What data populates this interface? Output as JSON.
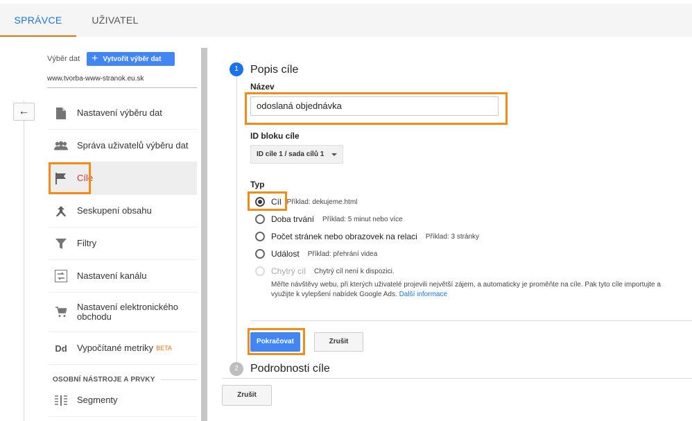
{
  "tabs": [
    {
      "label": "SPRÁVCE",
      "active": true
    },
    {
      "label": "UŽIVATEL",
      "active": false
    }
  ],
  "sidebar": {
    "view_label": "Výběr dat",
    "create_view_label": "Vytvořit výběr dat",
    "view_name": "www.tvorba-www-stranok.eu.sk",
    "back_icon": "arrow-left-icon",
    "items": [
      {
        "label": "Nastavení výběru dat",
        "icon": "document-icon"
      },
      {
        "label": "Správa uživatelů výběru dat",
        "icon": "people-icon"
      },
      {
        "label": "Cíle",
        "icon": "flag-icon",
        "active": true
      },
      {
        "label": "Seskupení obsahu",
        "icon": "merge-icon"
      },
      {
        "label": "Filtry",
        "icon": "filter-icon"
      },
      {
        "label": "Nastavení kanálu",
        "icon": "channel-icon"
      },
      {
        "label": "Nastavení elektronického obchodu",
        "icon": "cart-icon"
      },
      {
        "label": "Vypočítané metriky",
        "icon": "dd-icon",
        "badge": "BETA"
      }
    ],
    "section_header": "OSOBNÍ NÁSTROJE A PRVKY",
    "section_items": [
      {
        "label": "Segmenty",
        "icon": "segments-icon"
      }
    ]
  },
  "step1": {
    "number": "1",
    "title": "Popis cíle",
    "name_label": "Název",
    "name_value": "odoslaná objednávka",
    "slot_label": "ID bloku cíle",
    "slot_value": "ID cíle 1 / sada cílů 1",
    "type_label": "Typ",
    "types": [
      {
        "label": "Cíl",
        "hint": "Příklad: dekujeme.html",
        "checked": true
      },
      {
        "label": "Doba trvání",
        "hint": "Příklad: 5 minut nebo více"
      },
      {
        "label": "Počet stránek nebo obrazovek na relaci",
        "hint": "Příklad: 3 stránky"
      },
      {
        "label": "Událost",
        "hint": "Příklad: přehrání videa"
      },
      {
        "label": "Chytrý cíl",
        "hint": "Chytrý cíl není k dispozici.",
        "disabled": true
      }
    ],
    "smart_desc": "Měřte návštěvy webu, při kterých uživatelé projevili největší zájem, a automaticky je proměňte na cíle. Pak tyto cíle importujte a využijte k vylepšení nabídek Google Ads.",
    "smart_link": "Další informace",
    "continue_label": "Pokračovat",
    "cancel_label": "Zrušit"
  },
  "step2": {
    "number": "2",
    "title": "Podrobnosti cíle"
  },
  "footer_cancel_label": "Zrušit",
  "colors": {
    "accent": "#4285f4",
    "highlight": "#f28b17",
    "active_text": "#d93025"
  }
}
